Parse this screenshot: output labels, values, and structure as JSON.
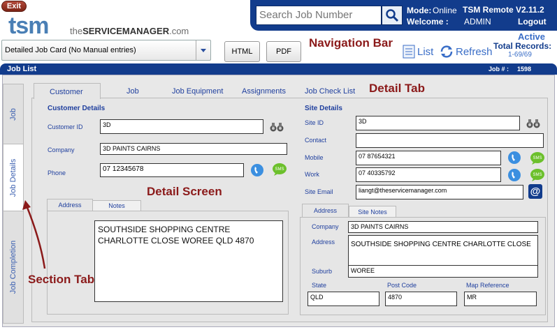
{
  "header": {
    "exit_label": "Exit",
    "logo_main": "tsm",
    "logo_sub_prefix": "the",
    "logo_sub_bold": "SERVICE",
    "logo_sub_mid": "MANAGER",
    "logo_sub_suffix": ".com",
    "search_placeholder": "Search Job Number",
    "mode_label": "Mode:",
    "mode_value": "Online",
    "welcome_label": "Welcome :",
    "welcome_value": "ADMIN",
    "app_version": "TSM Remote V2.11.2",
    "logout_label": "Logout",
    "status_label": "Active"
  },
  "toolbar": {
    "report_selected": "Detailed Job Card (No Manual entries)",
    "html_label": "HTML",
    "pdf_label": "PDF",
    "list_label": "List",
    "refresh_label": "Refresh",
    "total_records_label": "Total Records:",
    "total_records_value": "1-69/69"
  },
  "annotations": {
    "navigation_bar": "Navigation Bar",
    "detail_tab": "Detail Tab",
    "detail_screen": "Detail Screen",
    "section_tab": "Section Tab"
  },
  "job_list": {
    "title": "Job List",
    "job_number_label": "Job # :",
    "job_number_value": "1598"
  },
  "side_tabs": [
    "Job",
    "Job Details",
    "Job Completion"
  ],
  "detail_tabs": [
    "Customer",
    "Job",
    "Job Equipment",
    "Assignments",
    "Job Check List"
  ],
  "customer": {
    "section_title": "Customer Details",
    "id_label": "Customer ID",
    "id_value": "3D",
    "company_label": "Company",
    "company_value": "3D PAINTS CAIRNS",
    "phone_label": "Phone",
    "phone_value": "07 12345678",
    "sub_tabs": [
      "Address",
      "Notes"
    ],
    "address_line1": "SOUTHSIDE SHOPPING CENTRE",
    "address_line2": "CHARLOTTE CLOSE  WOREE  QLD  4870"
  },
  "site": {
    "section_title": "Site Details",
    "id_label": "Site ID",
    "id_value": "3D",
    "contact_label": "Contact",
    "contact_value": "",
    "mobile_label": "Mobile",
    "mobile_value": "07 87654321",
    "work_label": "Work",
    "work_value": "07 40335792",
    "email_label": "Site Email",
    "email_value": "liangt@theservicemanager.com",
    "sub_tabs": [
      "Address",
      "Site Notes"
    ],
    "company_label": "Company",
    "company_value": "3D PAINTS CAIRNS",
    "address_label": "Address",
    "address_value": "SOUTHSIDE SHOPPING CENTRE CHARLOTTE CLOSE",
    "suburb_label": "Suburb",
    "suburb_value": "WOREE",
    "state_label": "State",
    "state_value": "QLD",
    "postcode_label": "Post Code",
    "postcode_value": "4870",
    "mapref_label": "Map Reference",
    "mapref_value": "MR"
  },
  "icons": {
    "binoculars": "binoculars-icon",
    "phone": "phone-icon",
    "sms": "sms-icon",
    "email": "at-icon",
    "search": "magnifier-icon"
  },
  "colors": {
    "nav_blue": "#123c8c",
    "label_blue": "#1f3f9e",
    "annotation_red": "#8b1a1a",
    "sms_green": "#6cc02c",
    "phone_blue": "#3b8fe0"
  }
}
